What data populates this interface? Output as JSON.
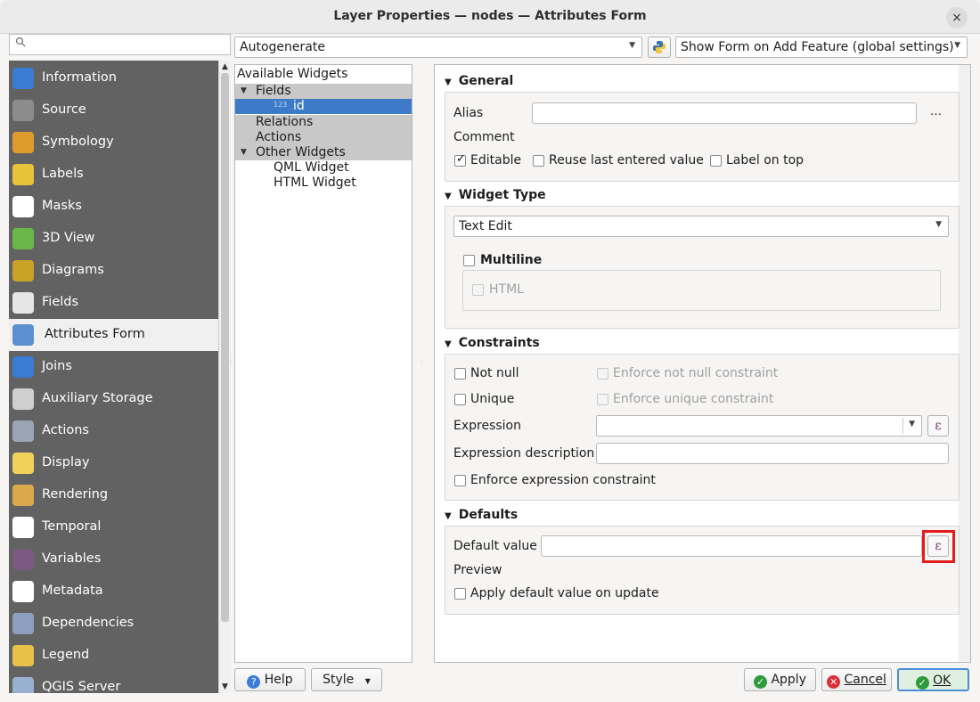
{
  "window": {
    "title": "Layer Properties — nodes — Attributes Form",
    "close_symbol": "×"
  },
  "search": {
    "placeholder": "",
    "icon": "search-icon"
  },
  "sidebar": {
    "items": [
      {
        "label": "Information",
        "icon": "information-icon",
        "color": "#3a7bd5"
      },
      {
        "label": "Source",
        "icon": "source-wrench-icon",
        "color": "#8c8c8c"
      },
      {
        "label": "Symbology",
        "icon": "symbology-brush-icon",
        "color": "#e09b2d"
      },
      {
        "label": "Labels",
        "icon": "labels-abc-icon",
        "color": "#e8c23a"
      },
      {
        "label": "Masks",
        "icon": "masks-abc-icon",
        "color": "#ffffff"
      },
      {
        "label": "3D View",
        "icon": "3d-cube-icon",
        "color": "#6bb74a"
      },
      {
        "label": "Diagrams",
        "icon": "diagrams-icon",
        "color": "#c9a227"
      },
      {
        "label": "Fields",
        "icon": "fields-icon",
        "color": "#e6e6e6"
      },
      {
        "label": "Attributes Form",
        "icon": "attributes-form-icon",
        "color": "#5b8fd0"
      },
      {
        "label": "Joins",
        "icon": "joins-icon",
        "color": "#3a7bd5"
      },
      {
        "label": "Auxiliary Storage",
        "icon": "auxiliary-storage-icon",
        "color": "#cfcfcf"
      },
      {
        "label": "Actions",
        "icon": "actions-gear-icon",
        "color": "#9aa5b5"
      },
      {
        "label": "Display",
        "icon": "display-bubble-icon",
        "color": "#f2d15b"
      },
      {
        "label": "Rendering",
        "icon": "rendering-brush-icon",
        "color": "#d9a94b"
      },
      {
        "label": "Temporal",
        "icon": "temporal-clock-icon",
        "color": "#ffffff"
      },
      {
        "label": "Variables",
        "icon": "variables-epsilon-icon",
        "color": "#7a5a80"
      },
      {
        "label": "Metadata",
        "icon": "metadata-icon",
        "color": "#ffffff"
      },
      {
        "label": "Dependencies",
        "icon": "dependencies-icon",
        "color": "#8ea0c0"
      },
      {
        "label": "Legend",
        "icon": "legend-icon",
        "color": "#e9c04a"
      },
      {
        "label": "QGIS Server",
        "icon": "qgis-server-icon",
        "color": "#9ab0d0"
      }
    ],
    "active_index": 8
  },
  "toolbar": {
    "layout_combo": "Autogenerate",
    "python_icon": "python-icon",
    "form_mode_combo": "Show Form on Add Feature (global settings)"
  },
  "tree": {
    "header": "Available Widgets",
    "fields_label": "Fields",
    "field_id": "id",
    "field_type_badge": "123",
    "relations": "Relations",
    "actions": "Actions",
    "other_widgets": "Other Widgets",
    "qml_widget": "QML Widget",
    "html_widget": "HTML Widget"
  },
  "general": {
    "title": "General",
    "alias_label": "Alias",
    "alias_value": "",
    "alias_more": "…",
    "comment_label": "Comment",
    "editable_label": "Editable",
    "editable_checked": true,
    "reuse_label": "Reuse last entered value",
    "reuse_checked": false,
    "label_on_top": "Label on top",
    "label_on_top_checked": false
  },
  "widget_type": {
    "title": "Widget Type",
    "selected": "Text Edit",
    "multiline_label": "Multiline",
    "multiline_checked": false,
    "html_label": "HTML",
    "html_checked": false
  },
  "constraints": {
    "title": "Constraints",
    "not_null_label": "Not null",
    "enforce_not_null_label": "Enforce not null constraint",
    "unique_label": "Unique",
    "enforce_unique_label": "Enforce unique constraint",
    "expression_label": "Expression",
    "expression_value": "",
    "expression_description_label": "Expression description",
    "expression_description_value": "",
    "enforce_expression_label": "Enforce expression constraint"
  },
  "defaults": {
    "title": "Defaults",
    "default_value_label": "Default value",
    "default_value": "",
    "preview_label": "Preview",
    "apply_on_update_label": "Apply default value on update",
    "apply_on_update_checked": false,
    "epsilon_symbol": "ε",
    "highlight_color": "#e21c1c"
  },
  "footer": {
    "help": "Help",
    "style": "Style",
    "apply": "Apply",
    "cancel": "Cancel",
    "ok": "OK"
  }
}
